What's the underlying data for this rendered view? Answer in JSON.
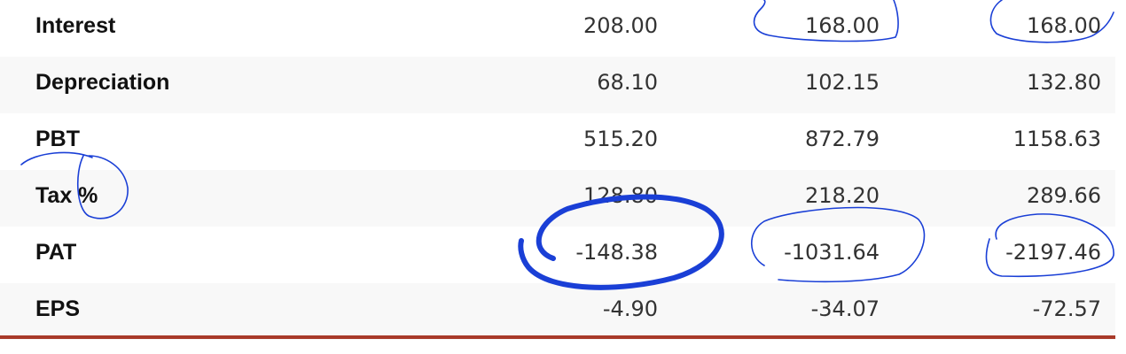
{
  "table": {
    "rows": [
      {
        "label": "Interest",
        "values": [
          "208.00",
          "168.00",
          "168.00"
        ]
      },
      {
        "label": "Depreciation",
        "values": [
          "68.10",
          "102.15",
          "132.80"
        ]
      },
      {
        "label": "PBT",
        "values": [
          "515.20",
          "872.79",
          "1158.63"
        ]
      },
      {
        "label": "Tax %",
        "values": [
          "128.80",
          "218.20",
          "289.66"
        ]
      },
      {
        "label": "PAT",
        "values": [
          "-148.38",
          "-1031.64",
          "-2197.46"
        ]
      },
      {
        "label": "EPS",
        "values": [
          "-4.90",
          "-34.07",
          "-72.57"
        ]
      }
    ]
  },
  "colors": {
    "accent_rule": "#a83a2a",
    "annotation_ink": "#1a3fd6",
    "row_alt_bg": "#f8f8f8"
  }
}
